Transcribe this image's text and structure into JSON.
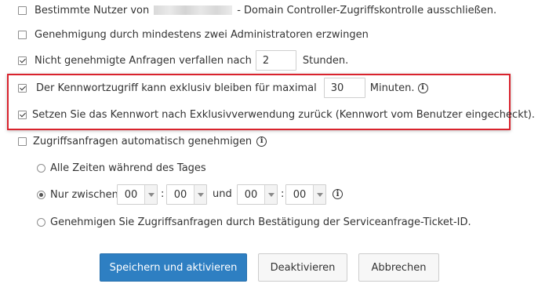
{
  "options": {
    "exclude_users": {
      "prefix": "Bestimmte Nutzer von",
      "suffix": "- Domain Controller-Zugriffskontrolle ausschließen."
    },
    "dual_approval": {
      "label": "Genehmigung durch mindestens zwei Administratoren erzwingen"
    },
    "expire_requests": {
      "label_before": "Nicht genehmigte Anfragen verfallen nach",
      "value": "2",
      "label_after": "Stunden."
    },
    "exclusive_access": {
      "label_before": "Der Kennwortzugriff kann exklusiv bleiben für maximal",
      "value": "30",
      "label_after": "Minuten."
    },
    "reset_password": {
      "label": "Setzen Sie das Kennwort nach Exklusivverwendung zurück (Kennwort vom Benutzer eingecheckt)."
    },
    "auto_approve": {
      "label": "Zugriffsanfragen automatisch genehmigen"
    }
  },
  "auto_approve_modes": {
    "all_times": {
      "label": "Alle Zeiten während des Tages"
    },
    "only_between": {
      "label": "Nur zwischen",
      "start_hour": "00",
      "start_minute": "00",
      "and_label": "und",
      "end_hour": "00",
      "end_minute": "00",
      "colon": ":"
    },
    "ticket": {
      "label": "Genehmigen Sie Zugriffsanfragen durch Bestätigung der Serviceanfrage-Ticket-ID."
    }
  },
  "buttons": {
    "save_activate": "Speichern und aktivieren",
    "deactivate": "Deaktivieren",
    "cancel": "Abbrechen"
  },
  "info_glyph": "i",
  "colors": {
    "primary": "#2e7fc2",
    "highlight": "#d9232d"
  }
}
